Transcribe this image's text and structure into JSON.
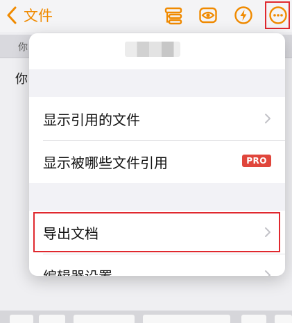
{
  "navbar": {
    "back_label": "文件"
  },
  "background": {
    "subbar_text": "你",
    "doc_text": "你"
  },
  "popup": {
    "group1": [
      {
        "label": "显示引用的文件",
        "has_chevron": true
      },
      {
        "label": "显示被哪些文件引用",
        "badge": "PRO"
      }
    ],
    "group2": [
      {
        "label": "导出文档",
        "has_chevron": true,
        "highlighted": true
      },
      {
        "label": "编辑器设置",
        "has_chevron": true
      }
    ]
  },
  "colors": {
    "accent": "#f08a00",
    "highlight": "#e0282e",
    "pro_badge": "#e0463c"
  }
}
